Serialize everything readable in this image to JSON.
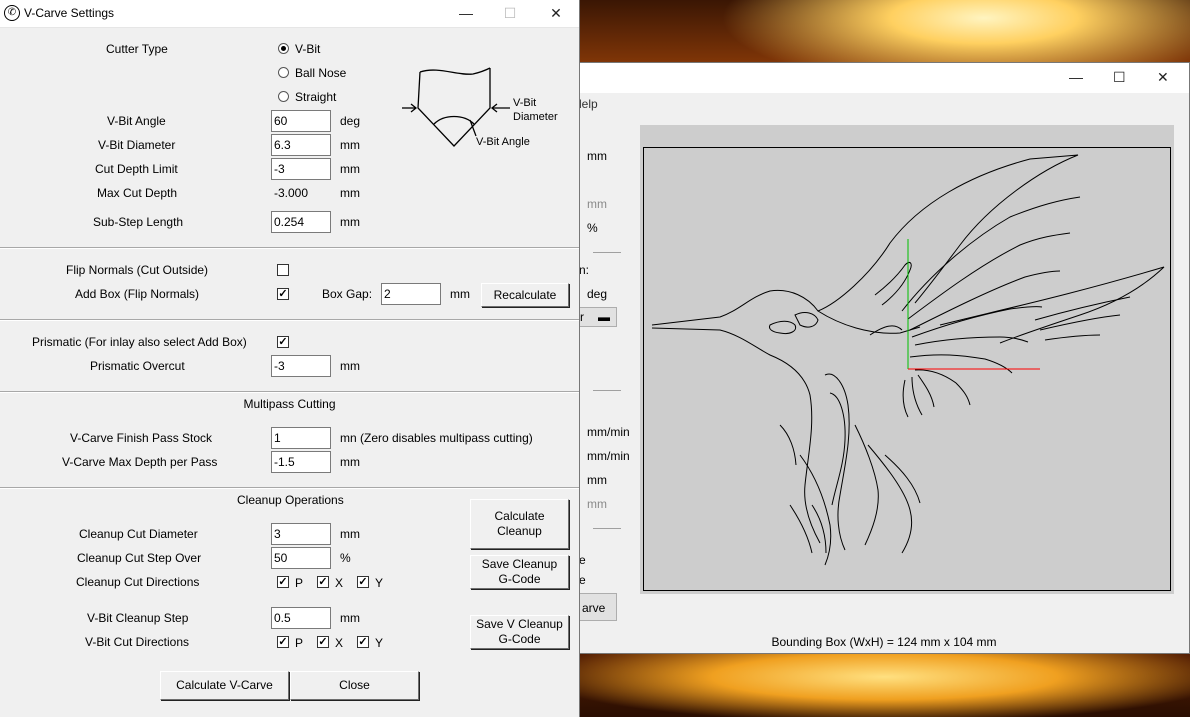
{
  "dialog": {
    "title": "V-Carve Settings",
    "cutter_type_label": "Cutter Type",
    "cutter_options": [
      "V-Bit",
      "Ball Nose",
      "Straight"
    ],
    "diagram": {
      "diameter_label_1": "V-Bit",
      "diameter_label_2": "Diameter",
      "angle_label": "V-Bit Angle"
    },
    "vbit_angle": {
      "label": "V-Bit Angle",
      "value": "60",
      "unit": "deg"
    },
    "vbit_diameter": {
      "label": "V-Bit Diameter",
      "value": "6.3",
      "unit": "mm"
    },
    "cut_depth_limit": {
      "label": "Cut Depth Limit",
      "value": "-3",
      "unit": "mm"
    },
    "max_cut_depth": {
      "label": "Max Cut Depth",
      "value": "-3.000",
      "unit": "mm"
    },
    "sub_step_length": {
      "label": "Sub-Step Length",
      "value": "0.254",
      "unit": "mm"
    },
    "flip_normals": {
      "label": "Flip Normals (Cut Outside)",
      "checked": false
    },
    "add_box": {
      "label": "Add Box (Flip Normals)",
      "checked": true
    },
    "box_gap": {
      "label": "Box Gap:",
      "value": "2",
      "unit": "mm"
    },
    "recalculate_button": "Recalculate",
    "prismatic": {
      "label": "Prismatic (For inlay also select Add Box)",
      "checked": true
    },
    "prismatic_overcut": {
      "label": "Prismatic Overcut",
      "value": "-3",
      "unit": "mm"
    },
    "multipass_header": "Multipass Cutting",
    "finish_pass_stock": {
      "label": "V-Carve Finish Pass Stock",
      "value": "1",
      "unit": "mn (Zero disables multipass cutting)"
    },
    "max_depth_per_pass": {
      "label": "V-Carve Max Depth per Pass",
      "value": "-1.5",
      "unit": "mm"
    },
    "cleanup_header": "Cleanup Operations",
    "cleanup_cut_diameter": {
      "label": "Cleanup Cut Diameter",
      "value": "3",
      "unit": "mm"
    },
    "cleanup_step_over": {
      "label": "Cleanup Cut Step Over",
      "value": "50",
      "unit": "%"
    },
    "cleanup_cut_directions": {
      "label": "Cleanup Cut Directions",
      "options": [
        "P",
        "X",
        "Y"
      ]
    },
    "vbit_cleanup_step": {
      "label": "V-Bit Cleanup Step",
      "value": "0.5",
      "unit": "mm"
    },
    "vbit_cut_directions": {
      "label": "V-Bit Cut Directions",
      "options": [
        "P",
        "X",
        "Y"
      ]
    },
    "calculate_cleanup_button": [
      "Calculate",
      "Cleanup"
    ],
    "save_cleanup_button": [
      "Save Cleanup",
      "G-Code"
    ],
    "save_v_cleanup_button": [
      "Save V Cleanup",
      "G-Code"
    ],
    "calculate_vcarve_button": "Calculate V-Carve",
    "close_button": "Close"
  },
  "main_window": {
    "menu_fragment": "lelp",
    "labels": [
      "mm",
      "mm",
      "%",
      "n:",
      "deg",
      "r",
      "mm/min",
      "mm/min",
      "mm",
      "mm",
      "e",
      "e",
      "arve"
    ],
    "bounding_box": "Bounding Box (WxH) = 124 mm  x 104 mm"
  },
  "colors": {
    "x_axis": "#ff0000",
    "y_axis": "#00c000",
    "canvas": "#cdcdcd",
    "dialog_bg": "#f0f0f0"
  }
}
